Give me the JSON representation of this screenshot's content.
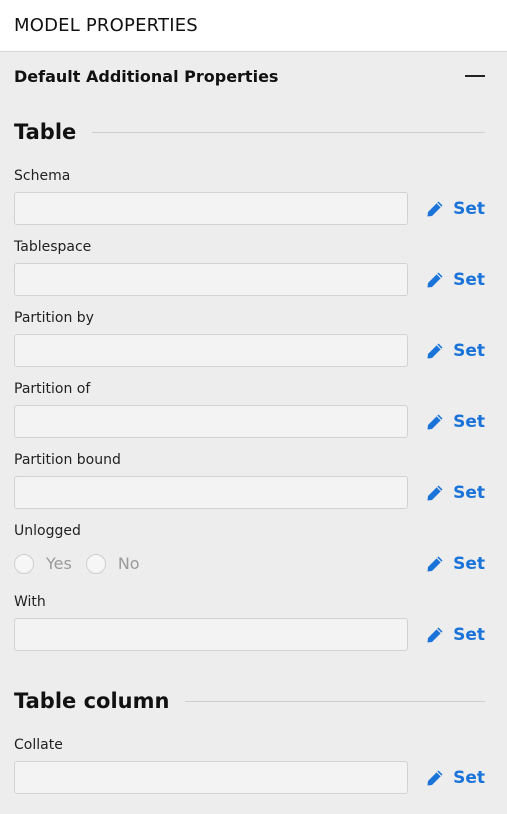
{
  "header": {
    "title": "MODEL PROPERTIES"
  },
  "section": {
    "title": "Default Additional Properties",
    "collapse_icon": "minus-icon"
  },
  "groups": {
    "table": {
      "title": "Table"
    },
    "table_column": {
      "title": "Table column"
    }
  },
  "set_label": "Set",
  "fields": {
    "schema": {
      "label": "Schema",
      "value": ""
    },
    "tablespace": {
      "label": "Tablespace",
      "value": ""
    },
    "partition_by": {
      "label": "Partition by",
      "value": ""
    },
    "partition_of": {
      "label": "Partition of",
      "value": ""
    },
    "partition_bound": {
      "label": "Partition bound",
      "value": ""
    },
    "unlogged": {
      "label": "Unlogged",
      "options": [
        "Yes",
        "No"
      ]
    },
    "with": {
      "label": "With",
      "value": ""
    },
    "collate": {
      "label": "Collate",
      "value": ""
    }
  },
  "colors": {
    "accent": "#1a73d9",
    "background": "#ededed"
  }
}
